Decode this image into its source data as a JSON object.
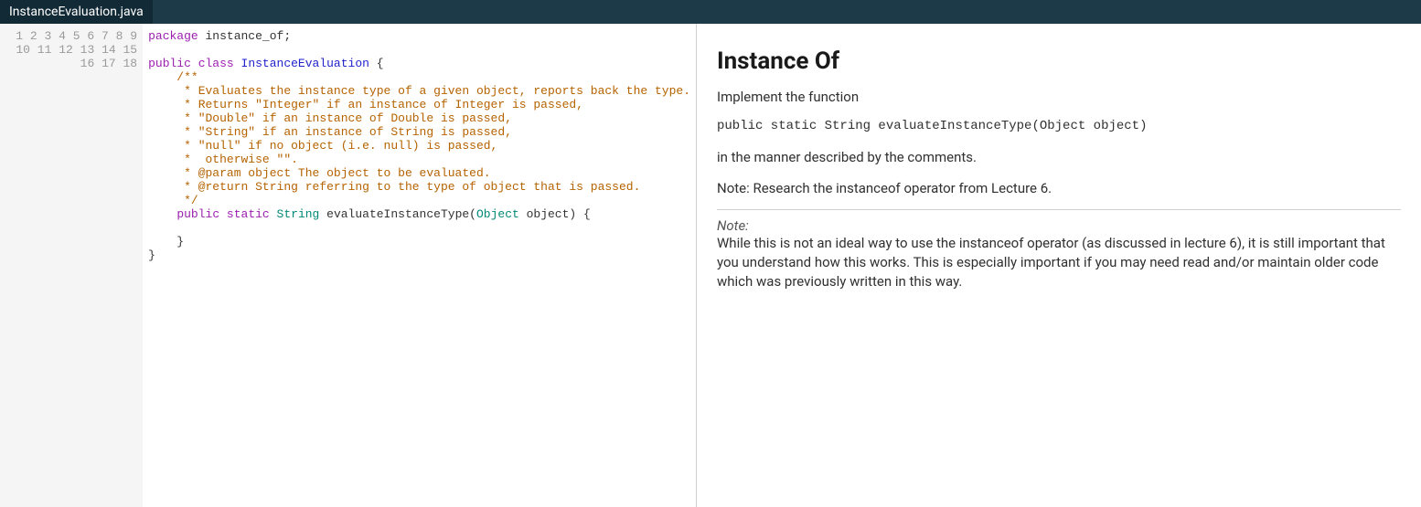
{
  "tab": {
    "filename": "InstanceEvaluation.java"
  },
  "code": {
    "line_numbers": [
      "1",
      "2",
      "3",
      "4",
      "5",
      "6",
      "7",
      "8",
      "9",
      "10",
      "11",
      "12",
      "13",
      "14",
      "15",
      "16",
      "17",
      "18"
    ],
    "l1_kw1": "package",
    "l1_pkg": " instance_of",
    "l1_semi": ";",
    "l3_kw1": "public",
    "l3_kw2": " class",
    "l3_cls": " InstanceEvaluation",
    "l3_brace": " {",
    "l4": "    /**",
    "l5": "     * Evaluates the instance type of a given object, reports back the type.",
    "l6": "     * Returns \"Integer\" if an instance of Integer is passed,",
    "l7": "     * \"Double\" if an instance of Double is passed,",
    "l8": "     * \"String\" if an instance of String is passed,",
    "l9": "     * \"null\" if no object (i.e. null) is passed,",
    "l10": "     *  otherwise \"\".",
    "l11": "     * @param object The object to be evaluated.",
    "l12": "     * @return String referring to the type of object that is passed.",
    "l13": "     */",
    "l14_indent": "    ",
    "l14_kw1": "public",
    "l14_kw2": " static",
    "l14_type1": " String",
    "l14_name": " evaluateInstanceType",
    "l14_p1": "(",
    "l14_type2": "Object",
    "l14_arg": " object",
    "l14_p2": ") {",
    "l16": "    }",
    "l17": "}"
  },
  "desc": {
    "title": "Instance Of",
    "p1": "Implement the function",
    "sig": "public static String evaluateInstanceType(Object object)",
    "p2": "in the manner described by the comments.",
    "p3": "Note: Research the instanceof operator from Lecture 6.",
    "note_label": "Note:",
    "note_body": "While this is not an ideal way to use the instanceof operator (as discussed in lecture 6), it is still important that you understand how this works. This is especially important if you may need read and/or maintain older code which was previously written in this way."
  }
}
